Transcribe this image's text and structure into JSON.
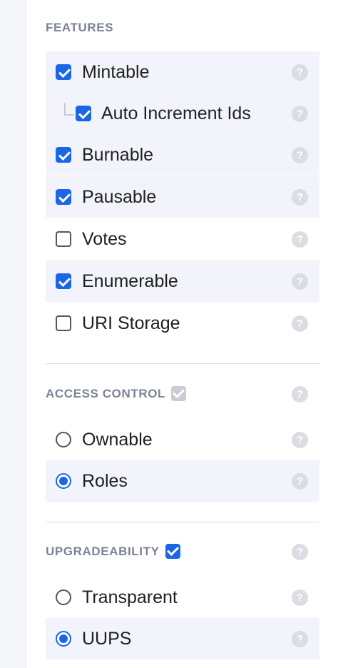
{
  "features": {
    "title": "FEATURES",
    "items": [
      {
        "label": "Mintable",
        "checked": true
      },
      {
        "label": "Auto Increment Ids",
        "checked": true
      },
      {
        "label": "Burnable",
        "checked": true
      },
      {
        "label": "Pausable",
        "checked": true
      },
      {
        "label": "Votes",
        "checked": false
      },
      {
        "label": "Enumerable",
        "checked": true
      },
      {
        "label": "URI Storage",
        "checked": false
      }
    ]
  },
  "access_control": {
    "title": "ACCESS CONTROL",
    "enabled": true,
    "toggle_disabled": true,
    "options": [
      {
        "label": "Ownable",
        "selected": false
      },
      {
        "label": "Roles",
        "selected": true
      }
    ]
  },
  "upgradeability": {
    "title": "UPGRADEABILITY",
    "enabled": true,
    "options": [
      {
        "label": "Transparent",
        "selected": false
      },
      {
        "label": "UUPS",
        "selected": true
      }
    ]
  },
  "help_icon_glyph": "?",
  "colors": {
    "accent": "#1a66e5",
    "row_highlight": "#f3f4fb",
    "section_title": "#7b8394"
  }
}
